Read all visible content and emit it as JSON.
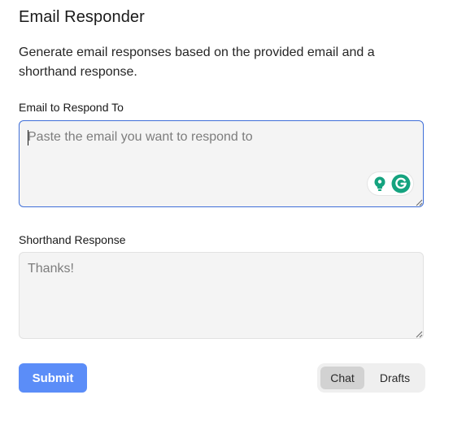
{
  "header": {
    "title": "Email Responder",
    "description": "Generate email responses based on the provided email and a shorthand response."
  },
  "email_field": {
    "label": "Email to Respond To",
    "value": "",
    "placeholder": "Paste the email you want to respond to"
  },
  "shorthand_field": {
    "label": "Shorthand Response",
    "value": "",
    "placeholder": "Thanks!"
  },
  "actions": {
    "submit_label": "Submit"
  },
  "view_toggle": {
    "options": [
      "Chat",
      "Drafts"
    ],
    "selected": "Chat"
  },
  "icons": {
    "grammarly_suggestions": "lightbulb-icon",
    "grammarly_logo": "grammarly-g-icon"
  },
  "colors": {
    "accent": "#5b8df8",
    "focus_border": "#3f6fd8",
    "grammarly_green": "#15a37f"
  }
}
